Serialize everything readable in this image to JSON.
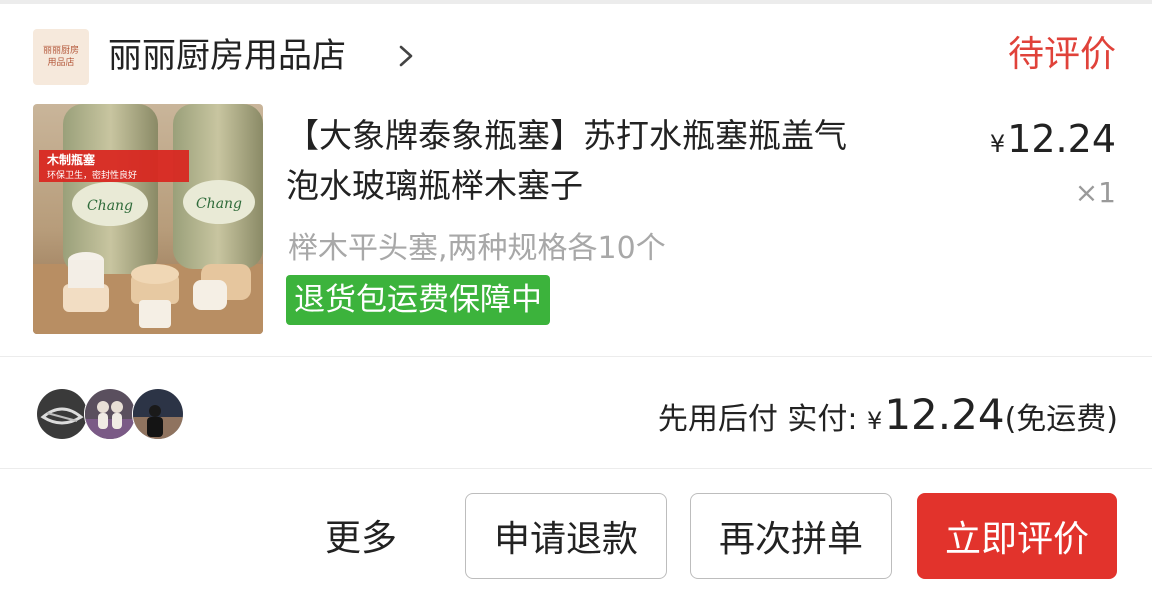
{
  "shop": {
    "logo_line1": "丽丽厨房",
    "logo_line2": "用品店",
    "name": "丽丽厨房用品店",
    "status": "待评价"
  },
  "product": {
    "title_line1": "【大象牌泰象瓶塞】苏打水瓶塞瓶盖气",
    "title_line2": "泡水玻璃瓶榉木塞子",
    "price_symbol": "¥",
    "price": "12.24",
    "quantity": "×1",
    "spec": "榉木平头塞,两种规格各10个",
    "badge": "退货包运费保障中",
    "thumb_caption_1": "木制瓶塞",
    "thumb_caption_2": "环保卫生，密封性良好",
    "bottle_brand": "Chang"
  },
  "summary": {
    "pay_label": "先用后付 实付:",
    "symbol": "¥",
    "amount": "12.24",
    "shipping": "(免运费)"
  },
  "actions": {
    "more": "更多",
    "refund": "申请退款",
    "reorder": "再次拼单",
    "review": "立即评价"
  },
  "colors": {
    "accent_red": "#e2332c",
    "status_red": "#e0423a",
    "badge_green": "#3cb33c"
  }
}
